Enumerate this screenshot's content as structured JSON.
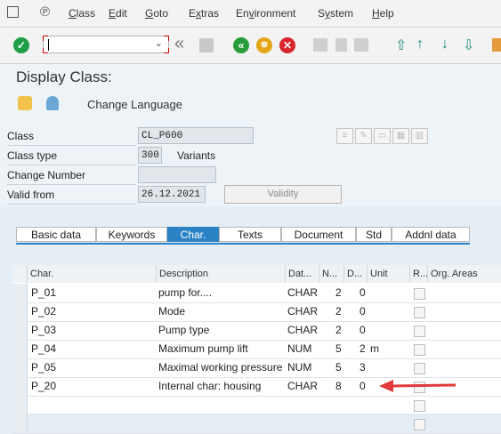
{
  "menu": [
    "Class",
    "Edit",
    "Goto",
    "Extras",
    "Environment",
    "System",
    "Help"
  ],
  "menu_underline": [
    "C",
    "E",
    "G",
    "x",
    "v",
    "y",
    "H"
  ],
  "toolbar": {
    "command_value": "",
    "icons": [
      "enter-icon",
      "command-dropdown-icon",
      "double-left-icon",
      "save-icon",
      "back-icon",
      "exit-icon",
      "cancel-icon",
      "print-icon",
      "find-icon",
      "find-next-icon",
      "first-page-icon",
      "prev-page-icon",
      "next-page-icon",
      "last-page-icon"
    ]
  },
  "screen": {
    "title": "Display Class:",
    "change_language": "Change Language"
  },
  "fields": {
    "class_label": "Class",
    "class_value": "CL_P600",
    "class_type_label": "Class type",
    "class_type_value": "300",
    "variants_label": "Variants",
    "change_number_label": "Change Number",
    "change_number_value": "",
    "valid_from_label": "Valid from",
    "valid_from_value": "26.12.2021",
    "validity_button": "Validity"
  },
  "tabs": [
    "Basic data",
    "Keywords",
    "Char.",
    "Texts",
    "Document",
    "Std",
    "Addnl data"
  ],
  "active_tab": "Char.",
  "table": {
    "headers": {
      "char": "Char.",
      "desc": "Description",
      "dat": "Dat...",
      "n": "N...",
      "d": "D...",
      "unit": "Unit",
      "r": "R...",
      "org": "Org. Areas"
    },
    "rows": [
      {
        "char": "P_01",
        "desc": "pump for....",
        "dat": "CHAR",
        "n": "2",
        "d": "0",
        "unit": ""
      },
      {
        "char": "P_02",
        "desc": "Mode",
        "dat": "CHAR",
        "n": "2",
        "d": "0",
        "unit": ""
      },
      {
        "char": "P_03",
        "desc": "Pump type",
        "dat": "CHAR",
        "n": "2",
        "d": "0",
        "unit": ""
      },
      {
        "char": "P_04",
        "desc": "Maximum pump lift",
        "dat": "NUM",
        "n": "5",
        "d": "2",
        "unit": "m"
      },
      {
        "char": "P_05",
        "desc": "Maximal working pressure",
        "dat": "NUM",
        "n": "5",
        "d": "3",
        "unit": ""
      },
      {
        "char": "P_20",
        "desc": "Internal char: housing",
        "dat": "CHAR",
        "n": "8",
        "d": "0",
        "unit": ""
      }
    ]
  },
  "colors": {
    "accent": "#2b83c6",
    "enter": "#1e9e47",
    "back": "#2a9d3b",
    "exit": "#e5a516",
    "cancel": "#d9262c",
    "arrow": "#e03a3a"
  }
}
